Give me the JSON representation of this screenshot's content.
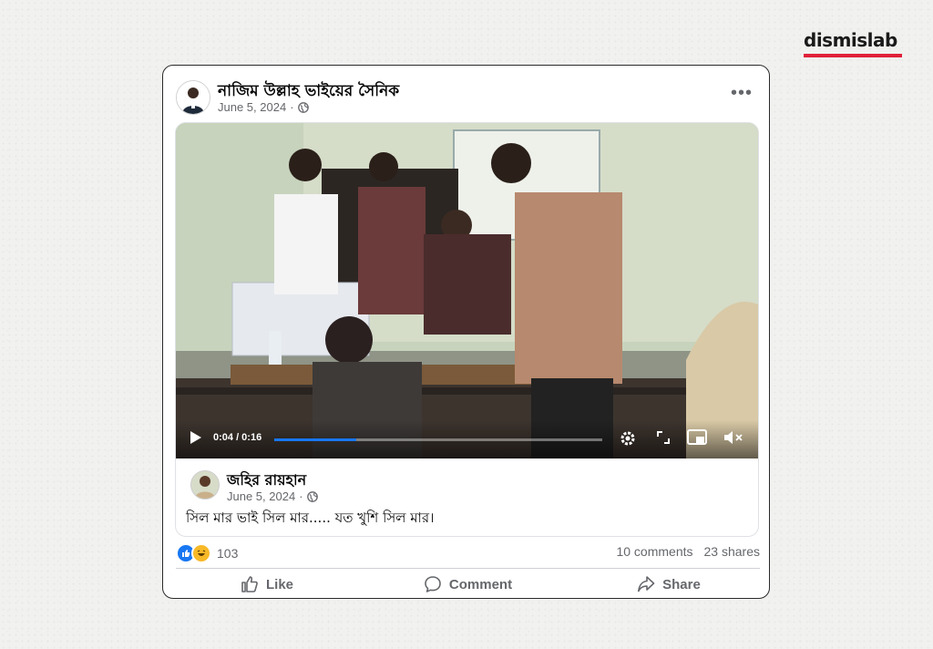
{
  "brand": {
    "name": "dismislab",
    "accent": "#e0213a"
  },
  "post": {
    "author": "নাজিম উল্লাহ ভাইয়ের সৈনিক",
    "date": "June 5, 2024",
    "privacy_icon": "globe-icon",
    "more_label": "•••"
  },
  "video": {
    "time": "0:04 / 0:16",
    "progress": 0.25,
    "icons": [
      "play-icon",
      "settings-icon",
      "fullscreen-icon",
      "pip-icon",
      "mute-icon"
    ]
  },
  "shared_post": {
    "author": "জহির রায়হান",
    "date": "June 5, 2024",
    "caption": "সিল মার ভাই সিল মার..... যত খুশি সিল মার।"
  },
  "stats": {
    "reactions_count": "103",
    "comments": "10 comments",
    "shares": "23 shares",
    "reaction_icons": [
      "like-reaction-icon",
      "haha-reaction-icon"
    ]
  },
  "actions": {
    "like": "Like",
    "comment": "Comment",
    "share": "Share"
  },
  "colors": {
    "fb_blue": "#1877f2",
    "meta_gray": "#65676b"
  }
}
